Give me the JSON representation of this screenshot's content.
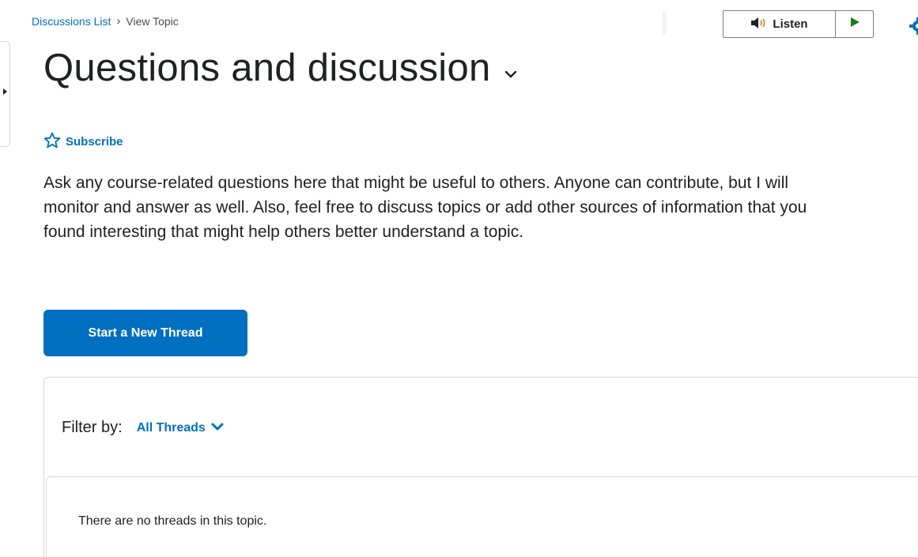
{
  "breadcrumb": {
    "parent": "Discussions List",
    "separator": "›",
    "current": "View Topic"
  },
  "toolbar": {
    "listen_label": "Listen",
    "accent_color": "#006fbf",
    "play_color": "#1a7d1a"
  },
  "topic": {
    "title": "Questions and discussion",
    "subscribe_label": "Subscribe",
    "description": "Ask any course-related questions here that might be useful to others. Anyone can contribute, but I will monitor and answer as well. Also, feel free to discuss topics or add other sources of information that you found interesting that might help others better understand a topic."
  },
  "actions": {
    "new_thread_label": "Start a New Thread"
  },
  "threads": {
    "filter_label": "Filter by:",
    "filter_value": "All Threads",
    "empty_message": "There are no threads in this topic."
  },
  "icons": {
    "speaker": "speaker-icon",
    "play": "play-icon",
    "gear": "gear-icon",
    "star": "star-outline-icon",
    "chevron": "chevron-down-icon",
    "side_toggle": "caret-right-icon"
  }
}
